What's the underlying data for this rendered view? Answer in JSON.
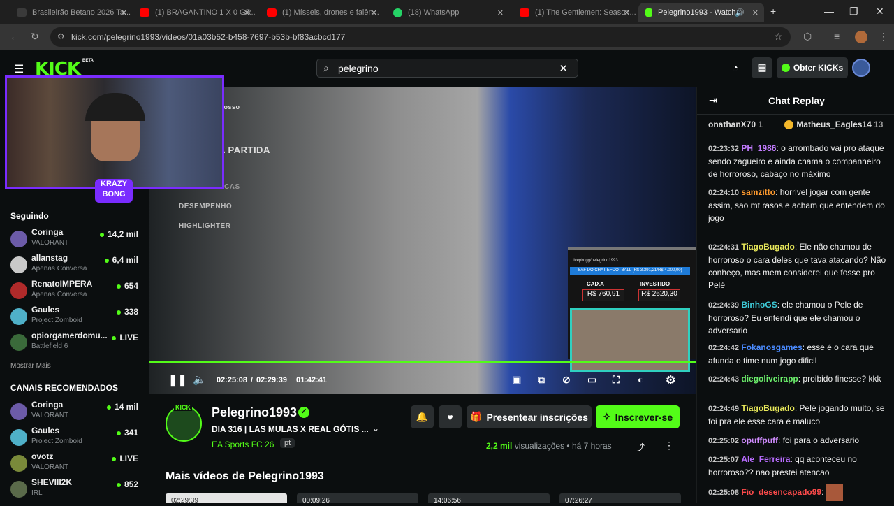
{
  "tabs": [
    {
      "label": "Brasileirão Betano 2026 Ta...",
      "color": "#2b2b2b"
    },
    {
      "label": "(1) BRAGANTINO 1 X 0 GR...",
      "color": "#ff0000"
    },
    {
      "label": "(1) Mísseis, drones e falên...",
      "color": "#ff0000"
    },
    {
      "label": "(18) WhatsApp",
      "color": "#25d366"
    },
    {
      "label": "(1) The Gentlemen: Season...",
      "color": "#ff0000"
    },
    {
      "label": "Pelegrino1993 - Watch",
      "color": "#53fc18"
    }
  ],
  "browser": {
    "url": "kick.com/pelegrino1993/videos/01a03b52-b458-7697-b53b-bf83acbcd177",
    "new_tab": "+"
  },
  "header": {
    "logo": "KICK",
    "beta": "BETA",
    "search_value": "pelegrino",
    "get_kicks": "Obter KICKs"
  },
  "sidebar": {
    "following_title": "Seguindo",
    "following": [
      {
        "name": "Coringa",
        "game": "VALORANT",
        "viewers": "14,2 mil",
        "avatar": "#6c5ba8"
      },
      {
        "name": "allanstag",
        "game": "Apenas Conversa",
        "viewers": "6,4 mil",
        "avatar": "#c9c9c9"
      },
      {
        "name": "RenatoIMPERA",
        "game": "Apenas Conversa",
        "viewers": "654",
        "avatar": "#b02a2a"
      },
      {
        "name": "Gaules",
        "game": "Project Zomboid",
        "viewers": "338",
        "avatar": "#4fb0c8"
      },
      {
        "name": "opiorgamerdomu...",
        "game": "Battlefield 6",
        "viewers": "LIVE",
        "avatar": "#3a6a3a"
      }
    ],
    "show_more": "Mostrar Mais",
    "recommended_title": "CANAIS RECOMENDADOS",
    "recommended": [
      {
        "name": "Coringa",
        "game": "VALORANT",
        "viewers": "14 mil",
        "avatar": "#6c5ba8"
      },
      {
        "name": "Gaules",
        "game": "Project Zomboid",
        "viewers": "341",
        "avatar": "#4fb0c8"
      },
      {
        "name": "ovotz",
        "game": "VALORANT",
        "viewers": "LIVE",
        "avatar": "#7a8a3a"
      },
      {
        "name": "SHEVIII2K",
        "game": "IRL",
        "viewers": "852",
        "avatar": "#5a6a4a"
      }
    ]
  },
  "video": {
    "menu_items": [
      "tosso",
      "A PARTIDA",
      "CAS",
      "DESEMPENHO",
      "HIGHLIGHTER"
    ],
    "hud_url": "livepix.gg/pelegrino1993",
    "hud_banner": "SAF DO CHAT EFOOTBALL (R$ 3.391,21/R$ 4.000,00)",
    "caixa_label": "CAIXA",
    "caixa_value": "R$ 760,91",
    "investido_label": "INVESTIDO",
    "investido_value": "R$ 2620,30",
    "current_time": "02:25:08",
    "separator": "/",
    "total_time": "02:29:39",
    "live_time": "01:42:41",
    "progress": 0.97
  },
  "webcam": {
    "badge_line1": "KRAZY",
    "badge_line2": "BONG"
  },
  "channel": {
    "logo": "KICK",
    "name": "Pelegrino1993",
    "title": "DIA 316 | LAS MULAS X REAL GÓTIS ...",
    "category": "EA Sports FC 26",
    "language": "pt",
    "views_count": "2,2 mil",
    "views_label": "visualizações",
    "bullet": "•",
    "time_ago": "há 7 horas",
    "gift_label": "Presentear inscrições",
    "subscribe_label": "Inscrever-se",
    "more_videos": "Mais vídeos de Pelegrino1993",
    "thumbs": [
      "02:29:39",
      "00:09:26",
      "14:06:56",
      "07:26:27"
    ]
  },
  "chat": {
    "title": "Chat Replay",
    "top_users": [
      {
        "name": "onathanX70",
        "count": "1"
      },
      {
        "name": "Matheus_Eagles14",
        "count": "13"
      }
    ],
    "messages": [
      {
        "time": "02:23:32",
        "user": "PH_1986",
        "color": "#c37cff",
        "text": " o arrombado vai pro ataque sendo zagueiro e ainda chama o companheiro de horroroso, cabaço no máximo"
      },
      {
        "time": "02:24:10",
        "user": "samzitto",
        "color": "#ff9a2e",
        "text": " horrivel jogar com gente assim, sao mt rasos e acham que entendem do jogo"
      },
      {
        "time": "02:24:31",
        "user": "TiagoBugado",
        "color": "#e8e85a",
        "text": " Ele não chamou de horroroso o cara deles que tava atacando? Não conheço, mas mem considerei que fosse pro Pelé"
      },
      {
        "time": "02:24:39",
        "user": "BinhoGS",
        "color": "#3ecbd8",
        "text": " ele chamou o Pele de horroroso? Eu entendi que ele chamou o adversario"
      },
      {
        "time": "02:24:42",
        "user": "Fokanosgames",
        "color": "#4b8bff",
        "text": " esse é o cara que afunda o time num jogo dificil"
      },
      {
        "time": "02:24:43",
        "user": "diegoliveirapp",
        "color": "#6cf06c",
        "text": " proibido finesse? kkk"
      },
      {
        "time": "02:24:49",
        "user": "TiagoBugado",
        "color": "#e8e85a",
        "text": " Pelé jogando muito, se foi pra ele esse cara é maluco"
      },
      {
        "time": "02:25:02",
        "user": "opuffpuff",
        "color": "#d08cff",
        "text": " foi para o adversario"
      },
      {
        "time": "02:25:07",
        "user": "Ale_Ferreira",
        "color": "#b86cff",
        "text": " qq aconteceu no horroroso?? nao prestei atencao"
      },
      {
        "time": "02:25:08",
        "user": "Fio_desencapado99",
        "color": "#ff4b4b",
        "text": ""
      }
    ]
  }
}
